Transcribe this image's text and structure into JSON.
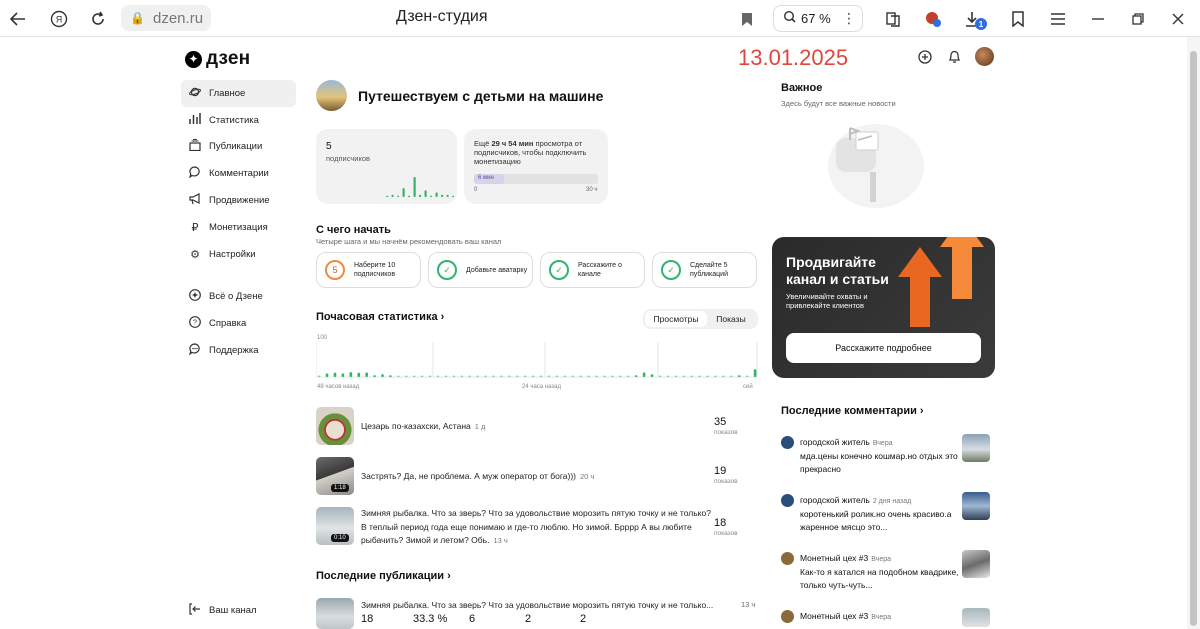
{
  "browser": {
    "url": "dzen.ru",
    "page_title": "Дзен-студия",
    "zoom": "67 %",
    "downloads_badge": "1"
  },
  "header": {
    "logo_text": "дзен",
    "date_overlay": "13.01.2025"
  },
  "sidebar": {
    "items": [
      {
        "label": "Главное",
        "icon": "home-planet-icon"
      },
      {
        "label": "Статистика",
        "icon": "bar-chart-icon"
      },
      {
        "label": "Публикации",
        "icon": "documents-icon"
      },
      {
        "label": "Комментарии",
        "icon": "speech-bubble-icon"
      },
      {
        "label": "Продвижение",
        "icon": "megaphone-icon"
      },
      {
        "label": "Монетизация",
        "icon": "ruble-icon"
      },
      {
        "label": "Настройки",
        "icon": "gear-icon"
      }
    ],
    "secondary": [
      {
        "label": "Всё о Дзене",
        "icon": "dzen-icon"
      },
      {
        "label": "Справка",
        "icon": "help-icon"
      },
      {
        "label": "Поддержка",
        "icon": "support-icon"
      }
    ],
    "your_channel": "Ваш канал"
  },
  "channel": {
    "name": "Путешествуем с детьми на машине"
  },
  "subscribers": {
    "count": "5",
    "label": "подписчиков",
    "sparkline": [
      0,
      1,
      0,
      4,
      0,
      9,
      1,
      3,
      0,
      2,
      1,
      1,
      0
    ]
  },
  "monetization": {
    "text_prefix": "Ещё ",
    "text_bold": "29 ч 54 мин",
    "text_suffix": " просмотра от подписчиков, чтобы подключить монетизацию",
    "bar_label": "6 мин",
    "progress_fraction": 0.003,
    "scale_start": "0",
    "scale_end": "30 ч"
  },
  "getting_started": {
    "title": "С чего начать",
    "subtitle": "Четыре шага и мы начнём рекомендовать ваш канал",
    "steps": [
      {
        "marker": "5",
        "state": "todo",
        "label": "Наберите 10 подписчиков"
      },
      {
        "marker": "✓",
        "state": "done",
        "label": "Добавьте аватарку"
      },
      {
        "marker": "✓",
        "state": "done",
        "label": "Расскажите о канале"
      },
      {
        "marker": "✓",
        "state": "done",
        "label": "Сделайте 5 публикаций"
      }
    ]
  },
  "hourly_stats": {
    "title": "Почасовая статистика",
    "tabs": [
      "Просмотры",
      "Показы"
    ],
    "selected_tab": "Просмотры"
  },
  "chart_data": {
    "type": "bar",
    "title": "Почасовая статистика",
    "ylim": [
      0,
      100
    ],
    "y_tick_top": "100",
    "x_tick_labels": [
      "48 часов назад",
      "24 часа назад",
      "сейчас"
    ],
    "x_tick_labels_visible": [
      "48 часов назад",
      "24 часа назад",
      "сей"
    ],
    "hours": 48,
    "values": [
      3,
      10,
      12,
      10,
      14,
      12,
      13,
      5,
      8,
      5,
      4,
      4,
      2,
      3,
      2,
      3,
      3,
      2,
      3,
      2,
      2,
      3,
      2,
      2,
      3,
      2,
      2,
      2,
      2,
      2,
      2,
      2,
      2,
      2,
      2,
      2,
      2,
      2,
      2,
      2,
      5,
      13,
      8,
      2,
      2,
      2,
      3,
      2,
      2,
      2,
      2,
      3,
      4,
      5,
      2,
      22
    ]
  },
  "top_publications": [
    {
      "title": "Цезарь по-казахски, Астана",
      "age": "1 д",
      "count": "35",
      "count_label": "показов",
      "duration": ""
    },
    {
      "title": "Застрять? Да, не проблема. А муж оператор от бога)))",
      "age": "20 ч",
      "count": "19",
      "count_label": "показов",
      "duration": "1:18"
    },
    {
      "title": "Зимняя рыбалка. Что за зверь? Что за удовольствие морозить пятую точку и не только? В теплый период года еще понимаю и где-то люблю. Но зимой. Брррр А вы любите рыбачить? Зимой и летом? Обь.",
      "age": "13 ч",
      "count": "18",
      "count_label": "показов",
      "duration": "0:10"
    }
  ],
  "latest_publications": {
    "title": "Последние публикации",
    "items": [
      {
        "title": "Зимняя рыбалка. Что за зверь? Что за удовольствие морозить пятую точку и не только...",
        "age": "13 ч",
        "stats": [
          "18",
          "33.3 %",
          "6",
          "2",
          "2"
        ]
      }
    ]
  },
  "important": {
    "title": "Важное",
    "subtitle": "Здесь будут все важные новости"
  },
  "promo": {
    "title": "Продвигайте канал и статьи",
    "subtitle": "Увеличивайте охваты и привлекайте клиентов",
    "button": "Расскажите подробнее"
  },
  "comments": {
    "title": "Последние комментарии",
    "items": [
      {
        "author": "городской житель",
        "time": "Вчера",
        "text": "мда.цены конечно кошмар.но отдых это прекрасно"
      },
      {
        "author": "городской житель",
        "time": "2 дня назад",
        "text": "коротенький ролик.но очень красиво.а жаренное мясцо это..."
      },
      {
        "author": "Монетный цех #3",
        "time": "Вчера",
        "text": "Как-то я катался на подобном квадрике, только чуть-чуть..."
      },
      {
        "author": "Монетный цех #3",
        "time": "Вчера",
        "text": ""
      }
    ]
  },
  "colors": {
    "accent_green": "#33b36b",
    "date_red": "#e0463b",
    "promo_orange": "#f26b22"
  }
}
